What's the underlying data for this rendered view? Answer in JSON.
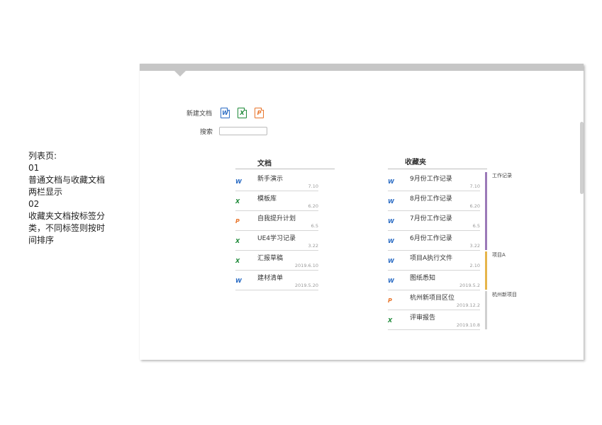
{
  "note": {
    "lines": [
      "列表页:",
      "01",
      "普通文档与收藏文档",
      "两栏显示",
      "02",
      "收藏夹文档按标签分",
      "类，不同标签则按时",
      "间排序"
    ]
  },
  "toolbar": {
    "new_doc_label": "新建文档",
    "icons": [
      {
        "name": "word-doc-icon",
        "letter": "W",
        "color": "#2b6cc4"
      },
      {
        "name": "excel-doc-icon",
        "letter": "X",
        "color": "#1f8a3a"
      },
      {
        "name": "ppt-doc-icon",
        "letter": "P",
        "color": "#e8742a"
      }
    ],
    "search_label": "搜索",
    "search_value": ""
  },
  "documents": {
    "title": "文档",
    "items": [
      {
        "type": "W",
        "name": "新手演示",
        "date": "7.10"
      },
      {
        "type": "X",
        "name": "模板库",
        "date": "6.20"
      },
      {
        "type": "P",
        "name": "自我提升计划",
        "date": "6.5"
      },
      {
        "type": "X",
        "name": "UE4学习记录",
        "date": "3.22"
      },
      {
        "type": "X",
        "name": "汇报草稿",
        "date": "2019.6.10"
      },
      {
        "type": "W",
        "name": "建材清单",
        "date": "2019.5.20"
      }
    ]
  },
  "favorites": {
    "title": "收藏夹",
    "items": [
      {
        "type": "W",
        "name": "9月份工作记录",
        "date": "7.10"
      },
      {
        "type": "W",
        "name": "8月份工作记录",
        "date": "6.20"
      },
      {
        "type": "W",
        "name": "7月份工作记录",
        "date": "6.5"
      },
      {
        "type": "W",
        "name": "6月份工作记录",
        "date": "3.22"
      },
      {
        "type": "W",
        "name": "项目A执行文件",
        "date": "2.10"
      },
      {
        "type": "W",
        "name": "图纸悉知",
        "date": "2019.5.2"
      },
      {
        "type": "P",
        "name": "杭州新项目区位",
        "date": "2019.12.2"
      },
      {
        "type": "X",
        "name": "评审报告",
        "date": "2019.10.8"
      }
    ],
    "tags": [
      {
        "label": "工作记录",
        "color": "#9b79b8",
        "from": 0,
        "count": 4
      },
      {
        "label": "项目A",
        "color": "#e6b54a",
        "from": 4,
        "count": 2
      },
      {
        "label": "杭州新项目",
        "color": "#d0d0d0",
        "from": 6,
        "count": 2
      }
    ]
  },
  "type_colors": {
    "W": "#2b6cc4",
    "X": "#1f8a3a",
    "P": "#e8742a"
  }
}
